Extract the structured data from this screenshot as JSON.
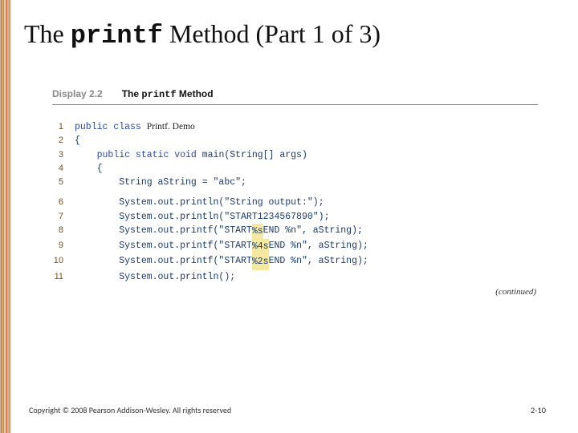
{
  "title": {
    "pre": "The ",
    "mono": "printf",
    "post": " Method (Part 1 of 3)"
  },
  "display": {
    "label": "Display 2.2",
    "title_pre": "The ",
    "title_mono": "printf",
    "title_post": " Method"
  },
  "code": {
    "l1_kw": "public class ",
    "l1_cls": "Printf. Demo",
    "l2": "{",
    "l3_ind": "    ",
    "l3_kw": "public static void ",
    "l3_rest": "main(String[] args)",
    "l4": "    {",
    "l5": "        String aString = \"abc\";",
    "l6": "        System.out.println(\"String output:\");",
    "l7a": "        System.out.println(\"START",
    "l7b": "1234567890\");",
    "l8a": "        System.out.printf(\"START",
    "l8b": "%s",
    "l8c": "END %n\", aString);",
    "l9a": "        System.out.printf(\"START",
    "l9b": "%4s",
    "l9c": "END %n\", aString);",
    "l10a": "        System.out.printf(\"START",
    "l10b": "%2s",
    "l10c": "END %n\", aString);",
    "l11": "        System.out.println();",
    "n1": "1",
    "n2": "2",
    "n3": "3",
    "n4": "4",
    "n5": "5",
    "n6": "6",
    "n7": "7",
    "n8": "8",
    "n9": "9",
    "n10": "10",
    "n11": "11"
  },
  "continued": "(continued)",
  "copyright": "Copyright © 2008 Pearson Addison-Wesley. All rights reserved",
  "page": "2-10"
}
